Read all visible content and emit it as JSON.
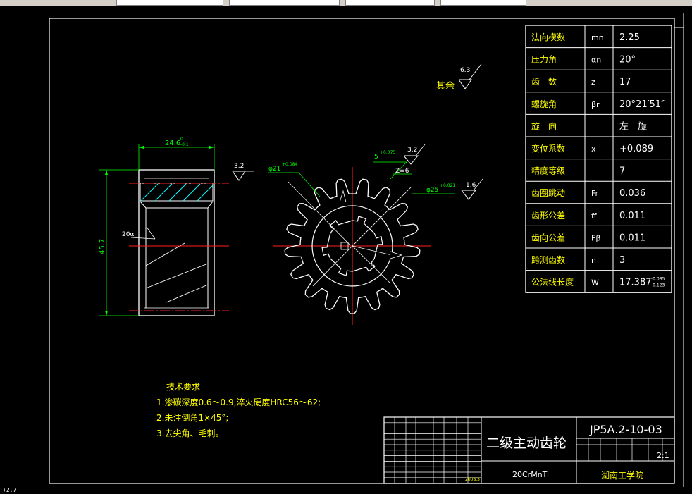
{
  "params": [
    {
      "name": "法向模数",
      "sym": "mn",
      "val": "2.25"
    },
    {
      "name": "压力角",
      "sym": "αn",
      "val": "20°"
    },
    {
      "name": "齿　数",
      "sym": "z",
      "val": "17"
    },
    {
      "name": "螺旋角",
      "sym": "βr",
      "val": "20°21′51″"
    },
    {
      "name": "旋　向",
      "sym": "",
      "val": "左　旋"
    },
    {
      "name": "变位系数",
      "sym": "x",
      "val": "+0.089"
    },
    {
      "name": "精度等级",
      "sym": "",
      "val": "7"
    },
    {
      "name": "齿圈跳动",
      "sym": "Fr",
      "val": "0.036"
    },
    {
      "name": "齿形公差",
      "sym": "ff",
      "val": "0.011"
    },
    {
      "name": "齿向公差",
      "sym": "Fβ",
      "val": "0.011"
    },
    {
      "name": "跨测齿数",
      "sym": "n",
      "val": "3"
    },
    {
      "name": "公法线长度",
      "sym": "W",
      "val": "17.387"
    }
  ],
  "w_tol_upper": "-0.085",
  "w_tol_lower": "-0.123",
  "roughness_rest_label": "其余",
  "roughness_rest_value": "6.3",
  "dims": {
    "width": "24.6",
    "width_tol_up": "0",
    "width_tol_low": "-0.1",
    "height": "45.7",
    "angle": "20α",
    "rough_side": "3.2",
    "rough_key": "3.2",
    "rough_bore": "1.6",
    "dia_hub": "φ21",
    "dia_hub_tol": "+0.084",
    "key_w": "5",
    "key_w_tol": "+0.075",
    "bore": "φ25",
    "bore_tol": "+0.021",
    "z_label": "Z=6"
  },
  "tech": {
    "title": "技术要求",
    "line1": "1.渗碳深度0.6～0.9,淬火硬度HRC56～62;",
    "line2": "2.未注倒角1×45°;",
    "line3": "3.去尖角、毛刺。"
  },
  "title_block": {
    "part_name": "二级主动齿轮",
    "drawing_no": "JP5A.2-10-03",
    "material": "20CrMnTi",
    "scale": "2:1",
    "school": "湖南工学院",
    "date": "2008.5"
  },
  "status_text": "+2.7"
}
